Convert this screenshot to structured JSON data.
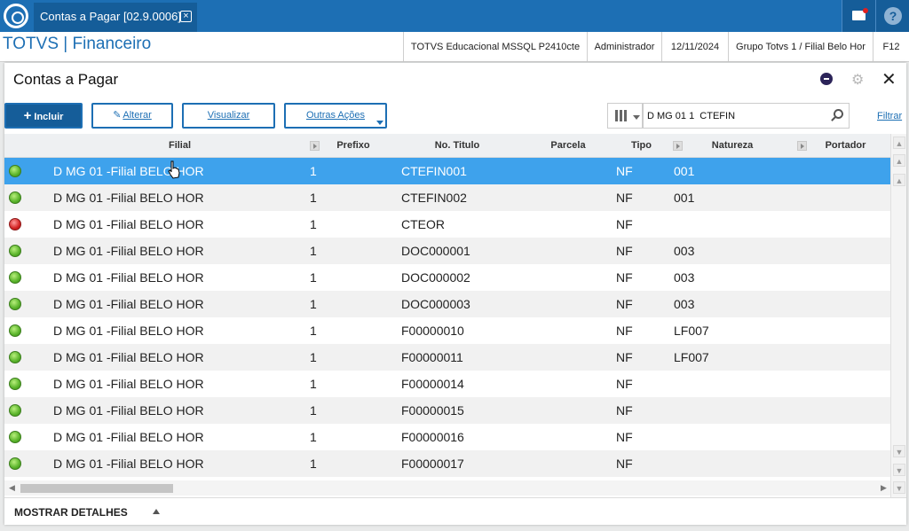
{
  "app_tab": {
    "title": "Contas a Pagar [02.9.0006]"
  },
  "header": {
    "brand": "TOTVS | Financeiro",
    "environment": "TOTVS Educacional MSSQL P2410cte",
    "user": "Administrador",
    "date": "12/11/2024",
    "company": "Grupo Totvs 1 / Filial Belo Hor",
    "shortcut": "F12"
  },
  "panel": {
    "title": "Contas a Pagar"
  },
  "toolbar": {
    "incluir": "Incluir",
    "alterar": "Alterar",
    "visualizar": "Visualizar",
    "outras_acoes": "Outras Ações",
    "search_value": "D MG 01 1  CTEFIN",
    "filtrar": "Filtrar"
  },
  "grid": {
    "columns": [
      "Filial",
      "Prefixo",
      "No. Titulo",
      "Parcela",
      "Tipo",
      "Natureza",
      "Portador"
    ],
    "rows": [
      {
        "status": "green",
        "filial": "D MG 01 -Filial BELO HOR",
        "prefixo": "1",
        "titulo": "CTEFIN001",
        "parcela": "",
        "tipo": "NF",
        "natureza": "001"
      },
      {
        "status": "green",
        "filial": "D MG 01 -Filial BELO HOR",
        "prefixo": "1",
        "titulo": "CTEFIN002",
        "parcela": "",
        "tipo": "NF",
        "natureza": "001"
      },
      {
        "status": "red",
        "filial": "D MG 01 -Filial BELO HOR",
        "prefixo": "1",
        "titulo": "CTEOR",
        "parcela": "",
        "tipo": "NF",
        "natureza": ""
      },
      {
        "status": "green",
        "filial": "D MG 01 -Filial BELO HOR",
        "prefixo": "1",
        "titulo": "DOC000001",
        "parcela": "",
        "tipo": "NF",
        "natureza": "003"
      },
      {
        "status": "green",
        "filial": "D MG 01 -Filial BELO HOR",
        "prefixo": "1",
        "titulo": "DOC000002",
        "parcela": "",
        "tipo": "NF",
        "natureza": "003"
      },
      {
        "status": "green",
        "filial": "D MG 01 -Filial BELO HOR",
        "prefixo": "1",
        "titulo": "DOC000003",
        "parcela": "",
        "tipo": "NF",
        "natureza": "003"
      },
      {
        "status": "green",
        "filial": "D MG 01 -Filial BELO HOR",
        "prefixo": "1",
        "titulo": "F00000010",
        "parcela": "",
        "tipo": "NF",
        "natureza": "LF007"
      },
      {
        "status": "green",
        "filial": "D MG 01 -Filial BELO HOR",
        "prefixo": "1",
        "titulo": "F00000011",
        "parcela": "",
        "tipo": "NF",
        "natureza": "LF007"
      },
      {
        "status": "green",
        "filial": "D MG 01 -Filial BELO HOR",
        "prefixo": "1",
        "titulo": "F00000014",
        "parcela": "",
        "tipo": "NF",
        "natureza": ""
      },
      {
        "status": "green",
        "filial": "D MG 01 -Filial BELO HOR",
        "prefixo": "1",
        "titulo": "F00000015",
        "parcela": "",
        "tipo": "NF",
        "natureza": ""
      },
      {
        "status": "green",
        "filial": "D MG 01 -Filial BELO HOR",
        "prefixo": "1",
        "titulo": "F00000016",
        "parcela": "",
        "tipo": "NF",
        "natureza": ""
      },
      {
        "status": "green",
        "filial": "D MG 01 -Filial BELO HOR",
        "prefixo": "1",
        "titulo": "F00000017",
        "parcela": "",
        "tipo": "NF",
        "natureza": ""
      }
    ]
  },
  "footer": {
    "details": "MOSTRAR DETALHES"
  },
  "colors": {
    "brand": "#1d6fb4",
    "selected_row": "#3ea2ec",
    "status_ok": "#59b32a",
    "status_error": "#d22222"
  }
}
